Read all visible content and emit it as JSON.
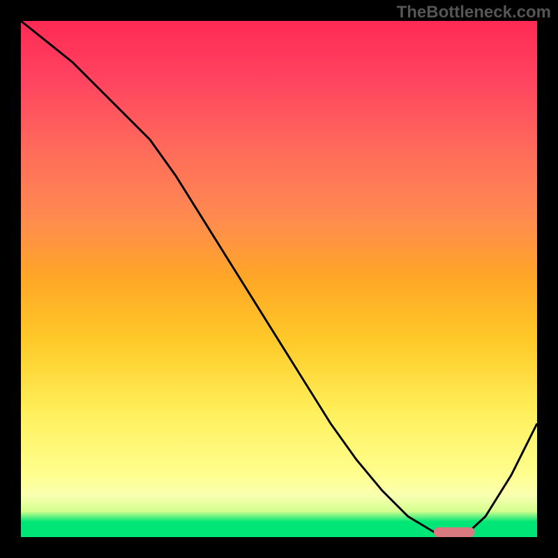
{
  "watermark": "TheBottleneck.com",
  "chart_data": {
    "type": "line",
    "title": "",
    "xlabel": "",
    "ylabel": "",
    "xlim": [
      0,
      100
    ],
    "ylim": [
      0,
      100
    ],
    "series": [
      {
        "name": "curve",
        "x": [
          0,
          5,
          10,
          15,
          20,
          25,
          30,
          35,
          40,
          45,
          50,
          55,
          60,
          65,
          70,
          75,
          80,
          83,
          86,
          90,
          95,
          100
        ],
        "values": [
          100,
          96,
          92,
          87,
          82,
          77,
          70,
          62,
          54,
          46,
          38,
          30,
          22,
          15,
          9,
          4,
          1,
          0.3,
          0.3,
          4,
          12,
          22
        ]
      }
    ],
    "optimal_region": {
      "x_start": 80,
      "x_end": 88,
      "y": 1
    },
    "gradient_stops": [
      {
        "pct": 0,
        "color": "#00e676"
      },
      {
        "pct": 5,
        "color": "#d4ff8f"
      },
      {
        "pct": 12,
        "color": "#ffff8f"
      },
      {
        "pct": 25,
        "color": "#ffee58"
      },
      {
        "pct": 50,
        "color": "#ffa726"
      },
      {
        "pct": 75,
        "color": "#ff6b5a"
      },
      {
        "pct": 100,
        "color": "#ff2a55"
      }
    ]
  }
}
